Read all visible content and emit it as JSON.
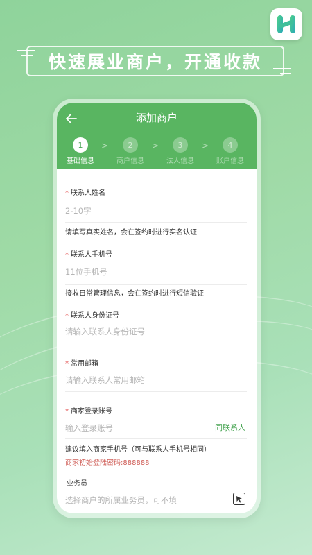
{
  "banner": {
    "text": "快速展业商户，开通收款"
  },
  "app": {
    "logo_icon": "app-logo-h-icon",
    "accent": "#59b561"
  },
  "screen": {
    "title": "添加商户",
    "back_icon": "back-arrow-icon",
    "steps": [
      {
        "number": "1",
        "label": "基础信息",
        "active": true
      },
      {
        "number": "2",
        "label": "商户信息",
        "active": false
      },
      {
        "number": "3",
        "label": "法人信息",
        "active": false
      },
      {
        "number": "4",
        "label": "账户信息",
        "active": false
      }
    ],
    "step_separator": ">"
  },
  "form": {
    "name": {
      "label": "联系人姓名",
      "placeholder": "2-10字",
      "hint": "请填写真实姓名，会在签约时进行实名认证"
    },
    "phone": {
      "label": "联系人手机号",
      "placeholder": "11位手机号",
      "hint": "接收日常管理信息，会在签约时进行短信验证"
    },
    "id_card": {
      "label": "联系人身份证号",
      "placeholder": "请输入联系人身份证号"
    },
    "email": {
      "label": "常用邮箱",
      "placeholder": "请输入联系人常用邮箱"
    },
    "login": {
      "label": "商家登录账号",
      "placeholder": "输入登录账号",
      "same_as_contact": "同联系人",
      "hint": "建议填入商家手机号（可与联系人手机号相同）",
      "default_password": "商家初始登陆密码:888888"
    },
    "salesman": {
      "label": "业务员",
      "placeholder": "选择商户的所属业务员，可不填",
      "select_icon": "select-cursor-icon"
    },
    "required_mark": "*"
  }
}
